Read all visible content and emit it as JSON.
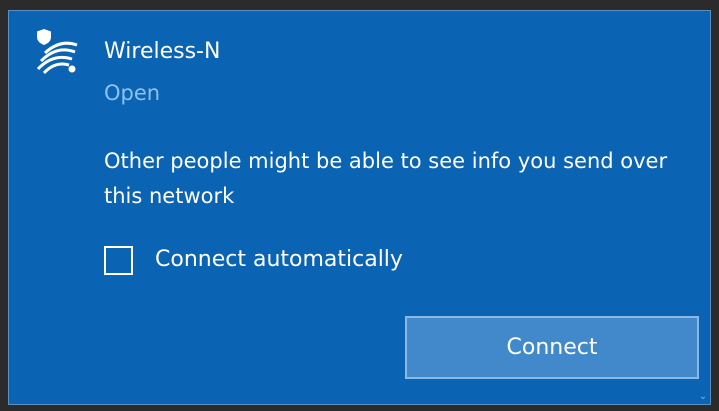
{
  "network": {
    "name": "Wireless-N",
    "status": "Open"
  },
  "warning": {
    "text": "Other people might be able to see info you send over this network"
  },
  "auto_connect": {
    "label": "Connect automatically",
    "checked": false
  },
  "actions": {
    "connect_label": "Connect"
  },
  "icons": {
    "network": "wifi-shield-icon",
    "scroll_down": "chevron-down-icon"
  },
  "colors": {
    "panel": "#0b63b3",
    "status_text": "#8ec1ef",
    "button": "#4289cc",
    "button_border": "#8cb9e4"
  }
}
